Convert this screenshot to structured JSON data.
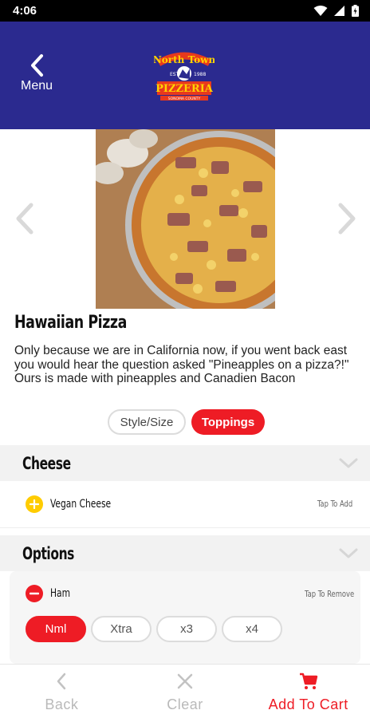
{
  "status_bar": {
    "time": "4:06"
  },
  "header": {
    "back_label": "Menu",
    "logo_alt": "North Town Pizzeria"
  },
  "product": {
    "title": "Hawaiian Pizza",
    "description": "Only because we are in California now, if you went back east you would hear the question asked \"Pineapples on a pizza?!\" Ours is made with pineapples and Canadien Bacon"
  },
  "tabs": [
    {
      "label": "Style/Size",
      "active": false
    },
    {
      "label": "Toppings",
      "active": true
    }
  ],
  "sections": {
    "cheese": {
      "title": "Cheese",
      "items": [
        {
          "name": "Vegan Cheese",
          "action": "Tap To Add"
        }
      ]
    },
    "options": {
      "title": "Options",
      "items": [
        {
          "name": "Ham",
          "action": "Tap To Remove",
          "quantities": [
            "Nml",
            "Xtra",
            "x3",
            "x4"
          ],
          "selected": "Nml"
        }
      ]
    }
  },
  "bottom_bar": {
    "back": "Back",
    "clear": "Clear",
    "add_to_cart": "Add To Cart"
  },
  "colors": {
    "header": "#2b2a8f",
    "accent": "#ee1c25",
    "add": "#ffcc00"
  }
}
